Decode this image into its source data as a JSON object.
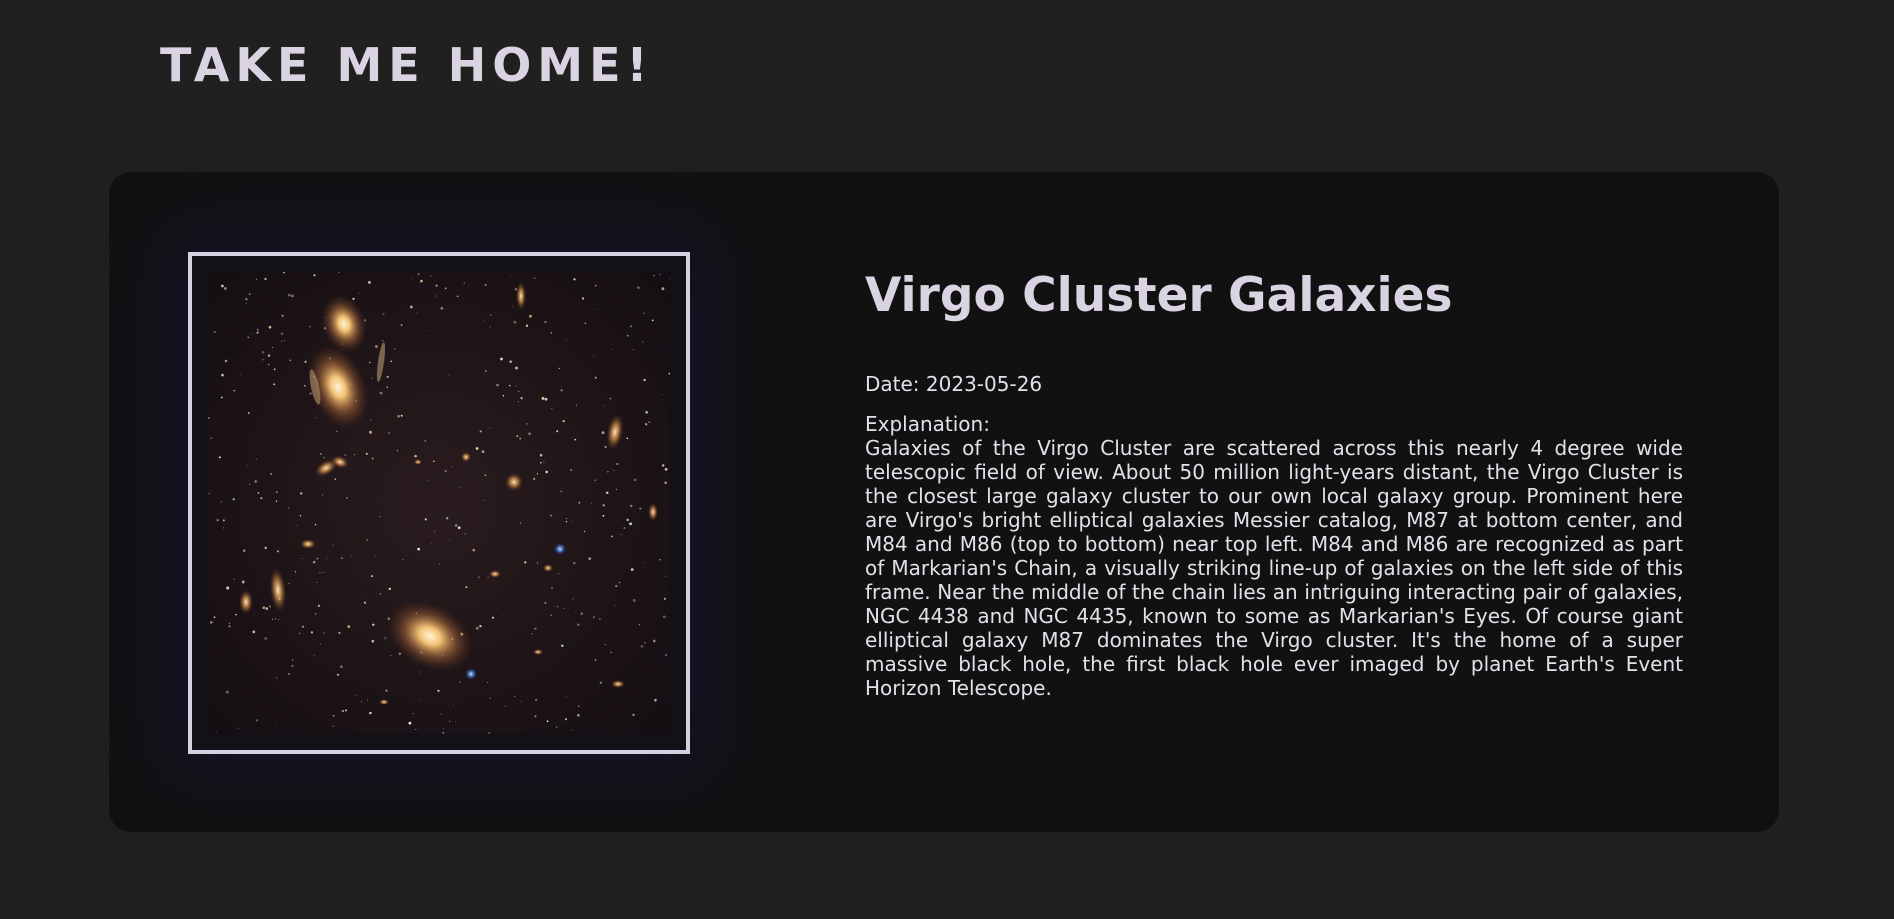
{
  "header": {
    "home_link": "TAKE ME HOME!"
  },
  "apod": {
    "image_alt": "Virgo Cluster Galaxies",
    "title": "Virgo Cluster Galaxies",
    "date_label": "Date:",
    "date": "2023-05-26",
    "explanation_label": "Explanation:",
    "explanation": "Galaxies of the Virgo Cluster are scattered across this nearly 4 degree wide telescopic field of view. About 50 million light-years distant, the Virgo Cluster is the closest large galaxy cluster to our own local galaxy group. Prominent here are Virgo's bright elliptical galaxies Messier catalog, M87 at bottom center, and M84 and M86 (top to bottom) near top left. M84 and M86 are recognized as part of Markarian's Chain, a visually striking line-up of galaxies on the left side of this frame. Near the middle of the chain lies an intriguing interacting pair of galaxies, NGC 4438 and NGC 4435, known to some as Markarian's Eyes. Of course giant elliptical galaxy M87 dominates the Virgo cluster. It's the home of a super massive black hole, the first black hole ever imaged by planet Earth's Event Horizon Telescope."
  },
  "colors": {
    "page_background": "#202020",
    "card_background": "#111111",
    "frame_border": "#d5d0e2",
    "text": "#d9d3e2"
  }
}
